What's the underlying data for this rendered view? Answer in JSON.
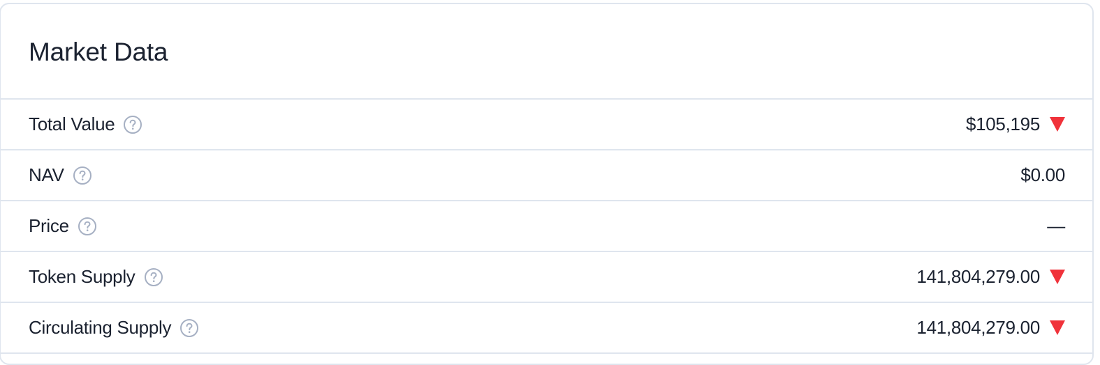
{
  "title": "Market Data",
  "rows": [
    {
      "label": "Total Value",
      "value": "$105,195",
      "trend": "down"
    },
    {
      "label": "NAV",
      "value": "$0.00",
      "trend": "none"
    },
    {
      "label": "Price",
      "value": "—",
      "trend": "none"
    },
    {
      "label": "Token Supply",
      "value": "141,804,279.00",
      "trend": "down"
    },
    {
      "label": "Circulating Supply",
      "value": "141,804,279.00",
      "trend": "down"
    }
  ],
  "icons": {
    "help": "question-circle-icon",
    "trend_down": "triangle-down-icon"
  },
  "colors": {
    "text": "#1b2230",
    "border": "#dfe5ee",
    "help_icon": "#a6b0c3",
    "trend_down": "#f0323a"
  }
}
